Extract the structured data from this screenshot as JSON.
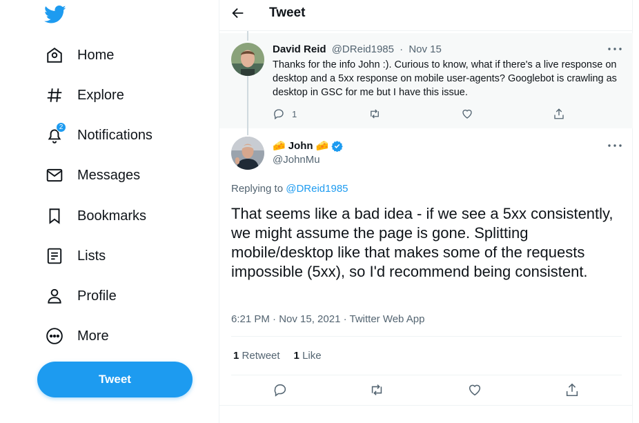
{
  "colors": {
    "accent": "#1d9bf0",
    "text": "#0f1419",
    "muted": "#536471",
    "verified": "#1d9bf0"
  },
  "sidebar": {
    "logo_icon": "twitter-bird-icon",
    "items": [
      {
        "label": "Home",
        "icon": "home-icon"
      },
      {
        "label": "Explore",
        "icon": "hashtag-icon"
      },
      {
        "label": "Notifications",
        "icon": "bell-icon",
        "badge": "2"
      },
      {
        "label": "Messages",
        "icon": "envelope-icon"
      },
      {
        "label": "Bookmarks",
        "icon": "bookmark-icon"
      },
      {
        "label": "Lists",
        "icon": "list-icon"
      },
      {
        "label": "Profile",
        "icon": "person-icon"
      },
      {
        "label": "More",
        "icon": "more-circle-icon"
      }
    ],
    "tweet_button": "Tweet"
  },
  "header": {
    "title": "Tweet"
  },
  "parent_tweet": {
    "name": "David Reid",
    "handle": "@DReid1985",
    "separator": "·",
    "date": "Nov 15",
    "text": "Thanks for the info John :). Curious to know, what if there's a live response on desktop and a 5xx response on mobile user-agents? Googlebot is crawling as desktop in GSC for me but I have this issue.",
    "reply_count": "1"
  },
  "main_tweet": {
    "name": "John",
    "name_emoji": "🧀",
    "handle": "@JohnMu",
    "replying_prefix": "Replying to",
    "replying_to": "@DReid1985",
    "text": "That seems like a bad idea - if we see a 5xx consistently, we might assume the page is gone. Splitting mobile/desktop like that makes some of the requests impossible (5xx), so I'd recommend being consistent.",
    "meta": "6:21 PM · Nov 15, 2021 · Twitter Web App",
    "retweets_count": "1",
    "retweets_label": "Retweet",
    "likes_count": "1",
    "likes_label": "Like"
  }
}
